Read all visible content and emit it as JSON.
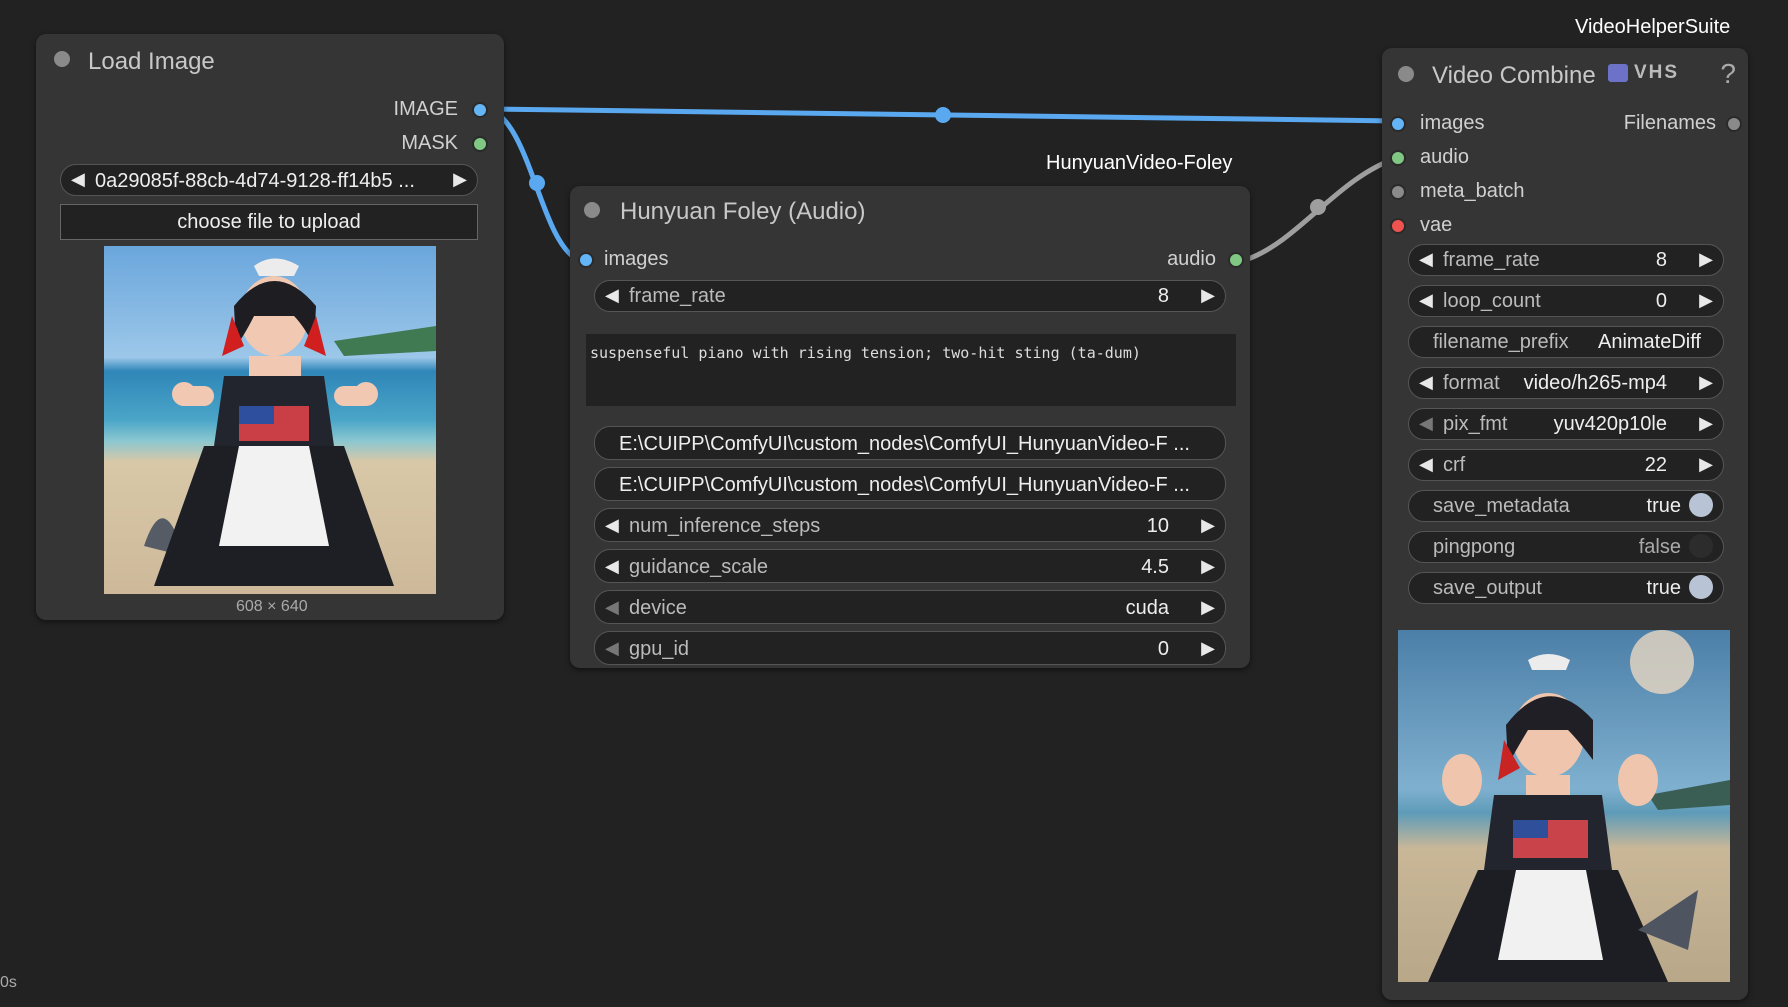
{
  "load_image": {
    "title": "Load Image",
    "outputs": [
      {
        "label": "IMAGE",
        "color": "#64b5f6"
      },
      {
        "label": "MASK",
        "color": "#81c784"
      }
    ],
    "file_select": "0a29085f-88cb-4d74-9128-ff14b5 ...",
    "upload_button": "choose file to upload",
    "image_size": "608 × 640"
  },
  "foley": {
    "group": "HunyuanVideo-Foley",
    "title": "Hunyuan Foley (Audio)",
    "input": {
      "label": "images",
      "color": "#64b5f6"
    },
    "output": {
      "label": "audio",
      "color": "#81c784"
    },
    "frame_rate": {
      "label": "frame_rate",
      "value": "8"
    },
    "prompt": "suspenseful piano with rising tension; two-hit sting (ta-dum)",
    "path1": "E:\\CUIPP\\ComfyUI\\custom_nodes\\ComfyUI_HunyuanVideo-F ...",
    "path2": "E:\\CUIPP\\ComfyUI\\custom_nodes\\ComfyUI_HunyuanVideo-F ...",
    "steps": {
      "label": "num_inference_steps",
      "value": "10"
    },
    "guidance": {
      "label": "guidance_scale",
      "value": "4.5"
    },
    "device": {
      "label": "device",
      "value": "cuda"
    },
    "gpu": {
      "label": "gpu_id",
      "value": "0"
    }
  },
  "video_combine": {
    "group": "VideoHelperSuite",
    "title": "Video Combine",
    "badge": "VHS",
    "help": "?",
    "inputs": [
      {
        "label": "images",
        "color": "#64b5f6"
      },
      {
        "label": "audio",
        "color": "#81c784"
      },
      {
        "label": "meta_batch",
        "color": "#8a8a8a"
      },
      {
        "label": "vae",
        "color": "#ef5350"
      }
    ],
    "output": {
      "label": "Filenames",
      "color": "#8a8a8a"
    },
    "frame_rate": {
      "label": "frame_rate",
      "value": "8"
    },
    "loop_count": {
      "label": "loop_count",
      "value": "0"
    },
    "filename_prefix": {
      "label": "filename_prefix",
      "value": "AnimateDiff"
    },
    "format": {
      "label": "format",
      "value": "video/h265-mp4"
    },
    "pix_fmt": {
      "label": "pix_fmt",
      "value": "yuv420p10le"
    },
    "crf": {
      "label": "crf",
      "value": "22"
    },
    "save_metadata": {
      "label": "save_metadata",
      "value": "true",
      "on": true
    },
    "pingpong": {
      "label": "pingpong",
      "value": "false",
      "on": false
    },
    "save_output": {
      "label": "save_output",
      "value": "true",
      "on": true
    }
  },
  "corner_text": "0s",
  "colors": {
    "image_link": "#5aa9f0",
    "audio_link": "#9e9e9e",
    "node_bg": "#353535",
    "canvas_bg": "#222222"
  }
}
